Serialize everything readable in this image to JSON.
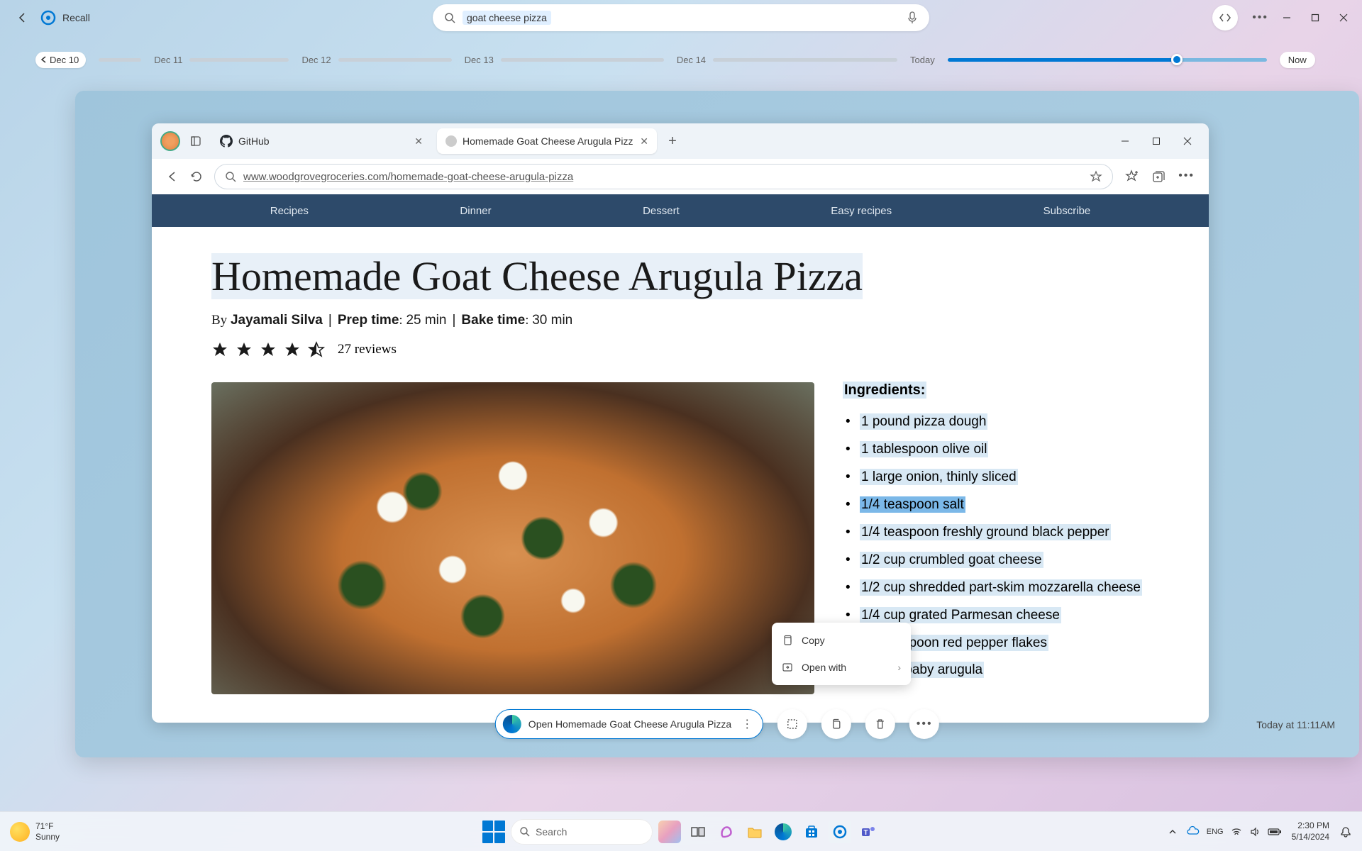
{
  "recall": {
    "title": "Recall",
    "search_value": "goat cheese pizza"
  },
  "timeline": {
    "dates": [
      "Dec 10",
      "Dec 11",
      "Dec 12",
      "Dec 13",
      "Dec 14"
    ],
    "today_label": "Today",
    "now_label": "Now"
  },
  "browser": {
    "tabs": [
      {
        "label": "GitHub"
      },
      {
        "label": "Homemade Goat Cheese Arugula Pizz"
      }
    ],
    "url": "www.woodgrovegroceries.com/homemade-goat-cheese-arugula-pizza"
  },
  "page": {
    "nav": [
      "Recipes",
      "Dinner",
      "Dessert",
      "Easy recipes",
      "Subscribe"
    ],
    "title": "Homemade Goat Cheese Arugula Pizza",
    "author": "Jayamali Silva",
    "prep_label": "Prep time",
    "prep_value": "25 min",
    "bake_label": "Bake time",
    "bake_value": "30 min",
    "reviews": "27 reviews",
    "ingredients_title": "Ingredients:",
    "ingredients": [
      "1 pound pizza dough",
      "1 tablespoon olive oil",
      "1 large onion, thinly sliced",
      "1/4 teaspoon salt",
      "1/4 teaspoon freshly ground black pepper",
      "1/2 cup crumbled goat cheese",
      "1/2 cup shredded part-skim mozzarella cheese",
      "1/4 cup grated Parmesan cheese",
      "1/4 teaspoon red pepper flakes",
      "2 cups baby arugula"
    ]
  },
  "context_menu": {
    "copy": "Copy",
    "open_with": "Open with"
  },
  "bottom": {
    "open_label": "Open Homemade Goat Cheese Arugula Pizza",
    "timestamp": "Today at 11:11AM"
  },
  "taskbar": {
    "weather_temp": "71°F",
    "weather_cond": "Sunny",
    "search_placeholder": "Search",
    "time": "2:30 PM",
    "date": "5/14/2024"
  }
}
